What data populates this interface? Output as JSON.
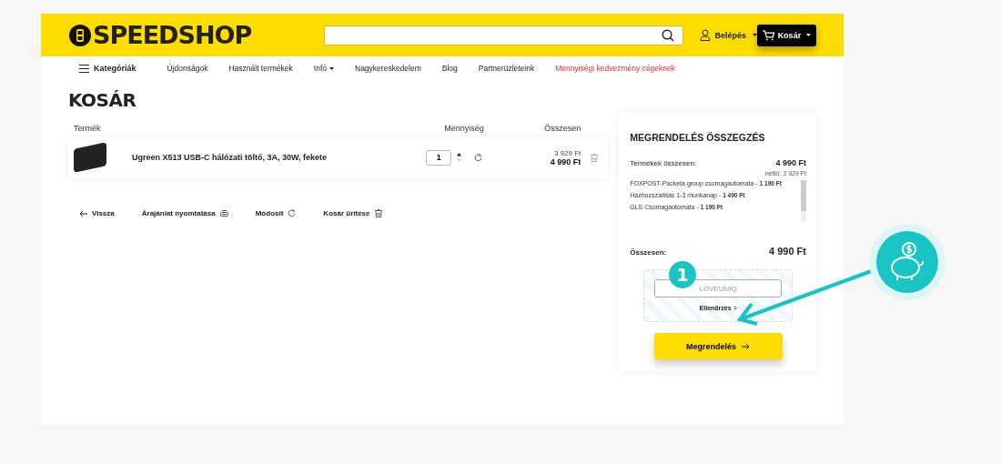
{
  "header": {
    "logo": "SPEEDSHOP",
    "login": "Belépés",
    "cart_button": "Kosár"
  },
  "nav": {
    "categories": "Kategóriák",
    "links": [
      {
        "label": "Újdonságok",
        "kind": "link",
        "dropdown": false
      },
      {
        "label": "Használt termékek",
        "kind": "link",
        "dropdown": false
      },
      {
        "label": "Infó",
        "kind": "link",
        "dropdown": true
      },
      {
        "label": "Nagykereskedelem",
        "kind": "link",
        "dropdown": false
      },
      {
        "label": "Blog",
        "kind": "link",
        "dropdown": false
      },
      {
        "label": "Partnerüzleteink",
        "kind": "link",
        "dropdown": false
      },
      {
        "label": "Mennyiségi kedvezmény cégeknek",
        "kind": "promo",
        "dropdown": false
      }
    ]
  },
  "page_title": "KOSÁR",
  "cart": {
    "columns": [
      "Termék",
      "Mennyiség",
      "Összesen"
    ],
    "items": [
      {
        "name": "Ugreen X513 USB-C hálózati töltő, 3A, 30W, fekete",
        "quantity": "1",
        "net": "3 929 Ft",
        "gross": "4 990 Ft"
      }
    ],
    "actions": [
      {
        "label": "Vissza",
        "kind": "back"
      },
      {
        "label": "Árajánlat nyomtatása",
        "kind": "print"
      },
      {
        "label": "Módosít",
        "kind": "refresh"
      },
      {
        "label": "Kosár ürítése",
        "kind": "trash"
      }
    ]
  },
  "summary": {
    "title": "MEGRENDELÉS ÖSSZEGZÉS",
    "products_label": "Termékek összesen:",
    "products_total": "4 990 Ft",
    "net": "nettó: 3 929 Ft",
    "shipping": [
      {
        "name": "FOXPOST-Packeta group csomagautomata -",
        "price": "1 190 Ft"
      },
      {
        "name": "Házhozszállítás 1-3 munkanap -",
        "price": "1 490 Ft"
      },
      {
        "name": "GLS Csomagautomata -",
        "price": "1 190 Ft"
      }
    ],
    "total_label": "Összesen:",
    "total": "4 990 Ft",
    "coupon": {
      "placeholder": "LOVEUNIQ",
      "check": "Ellenőrzés"
    },
    "order_button": "Megrendelés"
  },
  "callout": {
    "step": "1"
  }
}
